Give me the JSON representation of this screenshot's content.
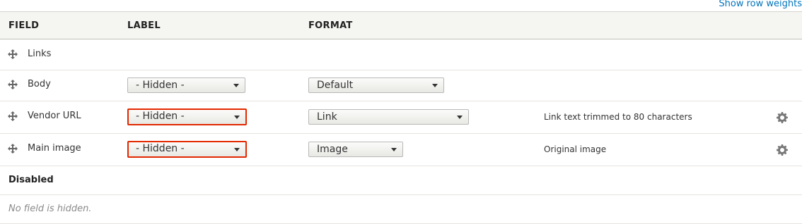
{
  "toolbar": {
    "show_row_weights": "Show row weights"
  },
  "table": {
    "headers": {
      "field": "FIELD",
      "label": "LABEL",
      "format": "FORMAT"
    },
    "rows": [
      {
        "field": "Links"
      },
      {
        "field": "Body",
        "label": "- Hidden -",
        "format": "Default"
      },
      {
        "field": "Vendor URL",
        "label": "- Hidden -",
        "format": "Link",
        "summary": "Link text trimmed to 80 characters"
      },
      {
        "field": "Main image",
        "label": "- Hidden -",
        "format": "Image",
        "summary": "Original image"
      }
    ]
  },
  "disabled_section": {
    "title": "Disabled",
    "empty_message": "No field is hidden."
  },
  "icons": {
    "drag": "drag-handle-icon",
    "settings": "gear-icon",
    "dropdown": "chevron-down-icon"
  },
  "colors": {
    "link": "#0074bd",
    "error_border": "#e32700",
    "header_bg": "#f5f5f2"
  }
}
